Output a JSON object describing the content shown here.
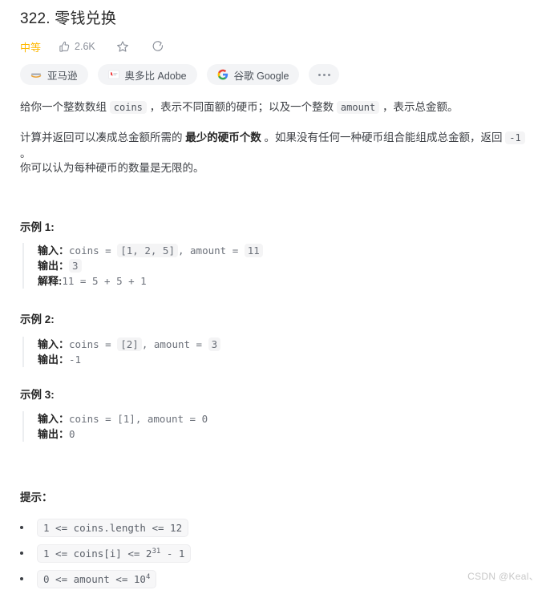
{
  "problem": {
    "title": "322. 零钱兑换",
    "difficulty": "中等",
    "likes": "2.6K"
  },
  "actions": [
    {
      "name": "thumbs-up",
      "icon": "thumbs-up-icon",
      "count": "2.6K"
    },
    {
      "name": "favorite",
      "icon": "star-icon",
      "count": ""
    },
    {
      "name": "share",
      "icon": "share-icon",
      "count": ""
    }
  ],
  "company_tags": [
    {
      "label": "亚马逊",
      "logo": "amazon-logo"
    },
    {
      "label": "奥多比 Adobe",
      "logo": "adobe-logo"
    },
    {
      "label": "谷歌 Google",
      "logo": "google-logo"
    },
    {
      "label": "",
      "logo": "ellipsis-icon"
    }
  ],
  "description": {
    "p1_a": "给你一个整数数组 ",
    "p1_code1": "coins",
    "p1_b": " ，表示不同面额的硬币；以及一个整数 ",
    "p1_code2": "amount",
    "p1_c": " ，表示总金额。",
    "p2_a": "计算并返回可以凑成总金额所需的 ",
    "p2_bold": "最少的硬币个数",
    "p2_b": " 。如果没有任何一种硬币组合能组成总金额，返回 ",
    "p2_code": "-1",
    "p2_c": " 。",
    "p3": "你可以认为每种硬币的数量是无限的。"
  },
  "examples": [
    {
      "heading": "示例 1:",
      "input_label": "输入：",
      "input_pre": "coins = ",
      "input_code1": "[1, 2, 5]",
      "input_mid": ", amount = ",
      "input_code2": "11",
      "output_label": "输出：",
      "output_code": "3",
      "explain_label": "解释:",
      "explain_text": "11 = 5 + 5 + 1"
    },
    {
      "heading": "示例 2:",
      "input_label": "输入：",
      "input_pre": "coins = ",
      "input_code1": "[2]",
      "input_mid": ", amount = ",
      "input_code2": "3",
      "output_label": "输出：",
      "output_code": "-1",
      "explain_label": "",
      "explain_text": ""
    },
    {
      "heading": "示例 3:",
      "input_label": "输入：",
      "input_pre": "coins = ",
      "input_code1": "[1]",
      "input_mid": ", amount = ",
      "input_code2": "0",
      "output_label": "输出：",
      "output_code": "0",
      "explain_label": "",
      "explain_text": ""
    }
  ],
  "hints": {
    "heading": "提示：",
    "items": [
      {
        "base": "1 <= coins.length <= 12",
        "sup": "",
        "tail": ""
      },
      {
        "base": "1 <= coins[i] <= 2",
        "sup": "31",
        "tail": " - 1"
      },
      {
        "base": "0 <= amount <= 10",
        "sup": "4",
        "tail": ""
      }
    ]
  },
  "watermark": "CSDN @Keal、",
  "colors": {
    "difficulty": "#ffb800",
    "text": "#3c3f44",
    "code_bg": "#f4f4f5",
    "tag_bg": "#f3f4f6"
  }
}
